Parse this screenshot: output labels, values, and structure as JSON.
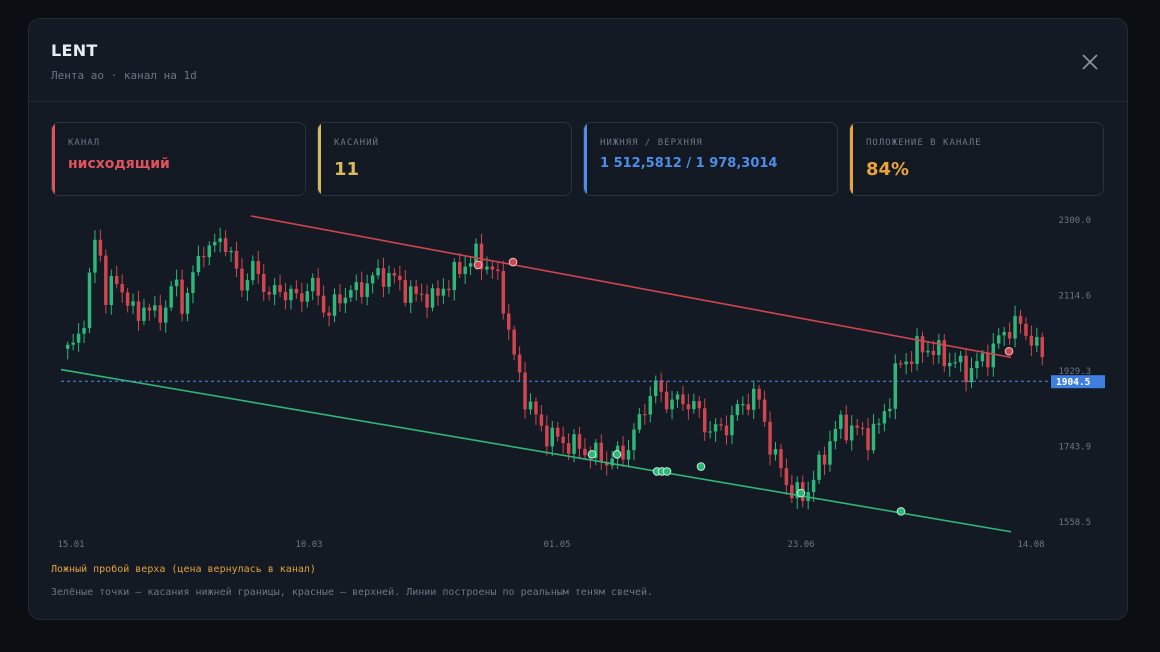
{
  "modal": {
    "title": "LENT",
    "subtitle": "Лента ао · канал на 1d"
  },
  "cards": [
    {
      "label": "канал",
      "value": "нисходящий",
      "color": "#e0525c"
    },
    {
      "label": "касаний",
      "value": "11",
      "color": "#d9b95c"
    },
    {
      "label": "нижняя / верхняя",
      "value": "1 512,5812 / 1 978,3014",
      "color": "#4f8de8"
    },
    {
      "label": "положение в канале",
      "value": "84%",
      "color": "#eaa53a"
    }
  ],
  "chart_data": {
    "type": "candlestick",
    "x_tick_labels": [
      "15.01",
      "10.03",
      "01.05",
      "23.06",
      "14.08"
    ],
    "y_tick_labels": [
      "2300.0",
      "2114.6",
      "1929.3",
      "1743.9",
      "1558.5"
    ],
    "y_range": [
      1558.5,
      2300.0
    ],
    "current_price": 1904.5,
    "current_price_label": "1904.5",
    "upper_line": {
      "start": 2300.0,
      "end": 1963.0,
      "color": "#d0454f"
    },
    "lower_line": {
      "start": 1933.0,
      "end": 1535.0,
      "color": "#2fb67a"
    },
    "candle_count": 180,
    "closes": [
      1980,
      2000,
      2100,
      2280,
      2110,
      2150,
      2120,
      2050,
      2100,
      2060,
      2080,
      2150,
      2090,
      2160,
      2240,
      2220,
      2270,
      2200,
      2140,
      2180,
      2160,
      2110,
      2130,
      2120,
      2100,
      2150,
      2110,
      2070,
      2100,
      2130,
      2120,
      2150,
      2160,
      2170,
      2150,
      2130,
      2110,
      2120,
      2100,
      2140,
      2160,
      2190,
      2210,
      2200,
      2180,
      2120,
      1990,
      1890,
      1840,
      1790,
      1770,
      1760,
      1750,
      1740,
      1730,
      1720,
      1710,
      1720,
      1740,
      1790,
      1860,
      1890,
      1860,
      1850,
      1860,
      1840,
      1800,
      1780,
      1790,
      1820,
      1850,
      1870,
      1840,
      1720,
      1690,
      1630,
      1620,
      1650,
      1700,
      1760,
      1800,
      1790,
      1780,
      1770,
      1790,
      1850,
      1940,
      1960,
      1980,
      1990,
      1975,
      1960,
      1950,
      1930,
      1940,
      1960,
      1990,
      2020,
      2050,
      2030,
      2010,
      1960
    ],
    "upper_touches": 3,
    "lower_touches": 8
  },
  "notes": {
    "false_breakout": "Ложный пробой верха (цена вернулась в канал)",
    "legend": "Зелёные точки — касания нижней границы, красные — верхней. Линии построены по реальным теням свечей."
  }
}
